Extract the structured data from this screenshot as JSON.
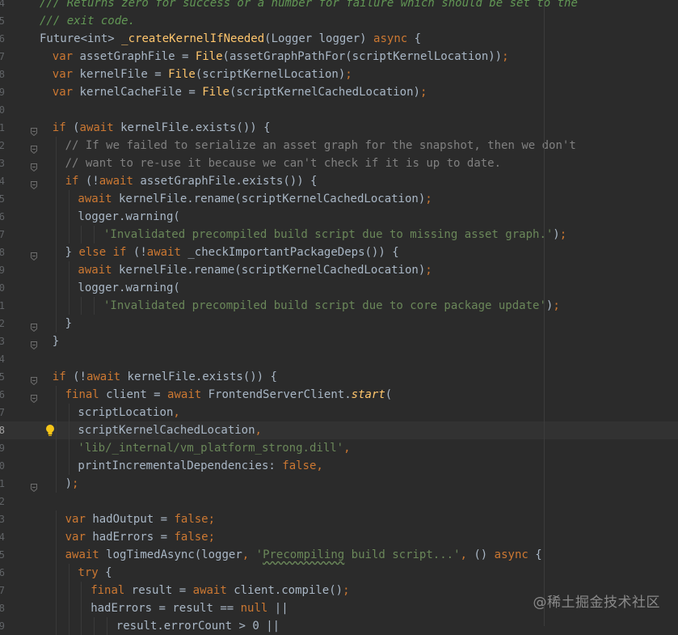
{
  "colors": {
    "background": "#2b2b2b",
    "keyword": "#cc7832",
    "string": "#6a8759",
    "comment": "#808080",
    "doc_comment": "#629755",
    "function_decl": "#ffc66d",
    "default_text": "#a9b7c6",
    "gutter": "#606366"
  },
  "icons": [
    "fold-marker-icon",
    "lightbulb-intention-icon"
  ],
  "watermark": "@稀土掘金技术社区",
  "lines": [
    {
      "n": "4",
      "indent": 0,
      "tokens": [
        [
          "doc",
          "/// Returns zero for success or a number for failure which should be set to the"
        ]
      ]
    },
    {
      "n": "5",
      "indent": 0,
      "tokens": [
        [
          "doc",
          "/// exit code."
        ]
      ]
    },
    {
      "n": "6",
      "indent": 0,
      "tokens": [
        [
          "plain",
          "Future<int> "
        ],
        [
          "fn",
          "_createKernelIfNeeded"
        ],
        [
          "plain",
          "(Logger logger) "
        ],
        [
          "kw",
          "async"
        ],
        [
          "plain",
          " {"
        ]
      ]
    },
    {
      "n": "7",
      "indent": 1,
      "tokens": [
        [
          "kw",
          "var"
        ],
        [
          "plain",
          " assetGraphFile = "
        ],
        [
          "fn",
          "File"
        ],
        [
          "plain",
          "(assetGraphPathFor(scriptKernelLocation))"
        ],
        [
          "kw",
          ";"
        ]
      ]
    },
    {
      "n": "8",
      "indent": 1,
      "tokens": [
        [
          "kw",
          "var"
        ],
        [
          "plain",
          " kernelFile = "
        ],
        [
          "fn",
          "File"
        ],
        [
          "plain",
          "(scriptKernelLocation)"
        ],
        [
          "kw",
          ";"
        ]
      ]
    },
    {
      "n": "9",
      "indent": 1,
      "tokens": [
        [
          "kw",
          "var"
        ],
        [
          "plain",
          " kernelCacheFile = "
        ],
        [
          "fn",
          "File"
        ],
        [
          "plain",
          "(scriptKernelCachedLocation)"
        ],
        [
          "kw",
          ";"
        ]
      ]
    },
    {
      "n": "0",
      "indent": 0,
      "tokens": []
    },
    {
      "n": "1",
      "indent": 1,
      "fold": true,
      "tokens": [
        [
          "kw",
          "if"
        ],
        [
          "plain",
          " ("
        ],
        [
          "kw",
          "await"
        ],
        [
          "plain",
          " kernelFile.exists()) {"
        ]
      ]
    },
    {
      "n": "2",
      "indent": 2,
      "fold": true,
      "tokens": [
        [
          "com",
          "// If we failed to serialize an asset graph for the snapshot, then we don't"
        ]
      ]
    },
    {
      "n": "3",
      "indent": 2,
      "fold": true,
      "tokens": [
        [
          "com",
          "// want to re-use it because we can't check if it is up to date."
        ]
      ]
    },
    {
      "n": "4",
      "indent": 2,
      "fold": true,
      "tokens": [
        [
          "kw",
          "if"
        ],
        [
          "plain",
          " (!"
        ],
        [
          "kw",
          "await"
        ],
        [
          "plain",
          " assetGraphFile.exists()) {"
        ]
      ]
    },
    {
      "n": "5",
      "indent": 3,
      "tokens": [
        [
          "kw",
          "await"
        ],
        [
          "plain",
          " kernelFile.rename(scriptKernelCachedLocation)"
        ],
        [
          "kw",
          ";"
        ]
      ]
    },
    {
      "n": "6",
      "indent": 3,
      "tokens": [
        [
          "plain",
          "logger.warning("
        ]
      ]
    },
    {
      "n": "7",
      "indent": 5,
      "tokens": [
        [
          "str",
          "'Invalidated precompiled build script due to missing asset graph.'"
        ],
        [
          "plain",
          ")"
        ],
        [
          "kw",
          ";"
        ]
      ]
    },
    {
      "n": "8",
      "indent": 2,
      "fold": true,
      "tokens": [
        [
          "plain",
          "} "
        ],
        [
          "kw",
          "else if"
        ],
        [
          "plain",
          " (!"
        ],
        [
          "kw",
          "await"
        ],
        [
          "plain",
          " _checkImportantPackageDeps()) {"
        ]
      ]
    },
    {
      "n": "9",
      "indent": 3,
      "tokens": [
        [
          "kw",
          "await"
        ],
        [
          "plain",
          " kernelFile.rename(scriptKernelCachedLocation)"
        ],
        [
          "kw",
          ";"
        ]
      ]
    },
    {
      "n": "0",
      "indent": 3,
      "tokens": [
        [
          "plain",
          "logger.warning("
        ]
      ]
    },
    {
      "n": "1",
      "indent": 5,
      "tokens": [
        [
          "str",
          "'Invalidated precompiled build script due to core package update'"
        ],
        [
          "plain",
          ")"
        ],
        [
          "kw",
          ";"
        ]
      ]
    },
    {
      "n": "2",
      "indent": 2,
      "fold": true,
      "tokens": [
        [
          "plain",
          "}"
        ]
      ]
    },
    {
      "n": "3",
      "indent": 1,
      "fold": true,
      "tokens": [
        [
          "plain",
          "}"
        ]
      ]
    },
    {
      "n": "4",
      "indent": 0,
      "tokens": []
    },
    {
      "n": "5",
      "indent": 1,
      "fold": true,
      "tokens": [
        [
          "kw",
          "if"
        ],
        [
          "plain",
          " (!"
        ],
        [
          "kw",
          "await"
        ],
        [
          "plain",
          " kernelFile.exists()) {"
        ]
      ]
    },
    {
      "n": "6",
      "indent": 2,
      "fold": true,
      "tokens": [
        [
          "kw",
          "final"
        ],
        [
          "plain",
          " client = "
        ],
        [
          "kw",
          "await"
        ],
        [
          "plain",
          " FrontendServerClient."
        ],
        [
          "fn ital",
          "start"
        ],
        [
          "plain",
          "("
        ]
      ]
    },
    {
      "n": "7",
      "indent": 3,
      "tokens": [
        [
          "plain",
          "scriptLocation"
        ],
        [
          "kw",
          ","
        ]
      ]
    },
    {
      "n": "8",
      "indent": 3,
      "caret": true,
      "bulb": true,
      "tokens": [
        [
          "plain",
          "scriptKernelCachedLocation"
        ],
        [
          "kw",
          ","
        ]
      ]
    },
    {
      "n": "9",
      "indent": 3,
      "tokens": [
        [
          "str",
          "'lib/_internal/vm_platform_strong.dill'"
        ],
        [
          "kw",
          ","
        ]
      ]
    },
    {
      "n": "0",
      "indent": 3,
      "tokens": [
        [
          "plain",
          "printIncrementalDependencies: "
        ],
        [
          "kw",
          "false,"
        ]
      ]
    },
    {
      "n": "1",
      "indent": 2,
      "fold": true,
      "tokens": [
        [
          "plain",
          ")"
        ],
        [
          "kw",
          ";"
        ]
      ]
    },
    {
      "n": "2",
      "indent": 0,
      "tokens": []
    },
    {
      "n": "3",
      "indent": 2,
      "tokens": [
        [
          "kw",
          "var"
        ],
        [
          "plain",
          " hadOutput = "
        ],
        [
          "kw",
          "false;"
        ]
      ]
    },
    {
      "n": "4",
      "indent": 2,
      "tokens": [
        [
          "kw",
          "var"
        ],
        [
          "plain",
          " hadErrors = "
        ],
        [
          "kw",
          "false;"
        ]
      ]
    },
    {
      "n": "5",
      "indent": 2,
      "tokens": [
        [
          "kw",
          "await"
        ],
        [
          "plain",
          " logTimedAsync(logger"
        ],
        [
          "kw",
          ", "
        ],
        [
          "str",
          "'"
        ],
        [
          "str typo",
          "Precompiling"
        ],
        [
          "str",
          " build script...'"
        ],
        [
          "kw",
          ", "
        ],
        [
          "plain",
          "() "
        ],
        [
          "kw",
          "async"
        ],
        [
          "plain",
          " {"
        ]
      ]
    },
    {
      "n": "6",
      "indent": 3,
      "tokens": [
        [
          "kw",
          "try"
        ],
        [
          "plain",
          " {"
        ]
      ]
    },
    {
      "n": "7",
      "indent": 4,
      "tokens": [
        [
          "kw",
          "final"
        ],
        [
          "plain",
          " result = "
        ],
        [
          "kw",
          "await"
        ],
        [
          "plain",
          " client.compile()"
        ],
        [
          "kw",
          ";"
        ]
      ]
    },
    {
      "n": "8",
      "indent": 4,
      "tokens": [
        [
          "plain",
          "hadErrors = result == "
        ],
        [
          "kw",
          "null"
        ],
        [
          "plain",
          " ||"
        ]
      ]
    },
    {
      "n": "9",
      "indent": 6,
      "tokens": [
        [
          "plain",
          "result.errorCount > 0 ||"
        ]
      ]
    }
  ]
}
